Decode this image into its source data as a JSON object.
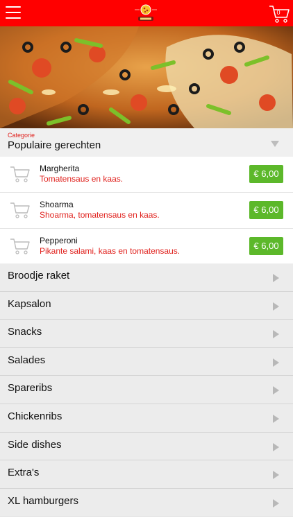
{
  "colors": {
    "brand": "#ff0000",
    "accent_text": "#e0221e",
    "price_bg": "#5cb82a"
  },
  "header": {
    "menu_icon": "hamburger-icon",
    "logo_icon": "pizza-logo-icon",
    "cart_icon": "cart-icon",
    "cart_count": "0"
  },
  "category_selector": {
    "label": "Categorie",
    "value": "Populaire gerechten"
  },
  "products": [
    {
      "name": "Margherita",
      "description": "Tomatensaus en kaas.",
      "price": "€ 6,00"
    },
    {
      "name": "Shoarma",
      "description": "Shoarma, tomatensaus en kaas.",
      "price": "€ 6,00"
    },
    {
      "name": "Pepperoni",
      "description": "Pikante salami, kaas en tomatensaus.",
      "price": "€ 6,00"
    }
  ],
  "categories": [
    "Broodje raket",
    "Kapsalon",
    "Snacks",
    "Salades",
    "Spareribs",
    "Chickenribs",
    "Side dishes",
    "Extra's",
    "XL hamburgers"
  ]
}
